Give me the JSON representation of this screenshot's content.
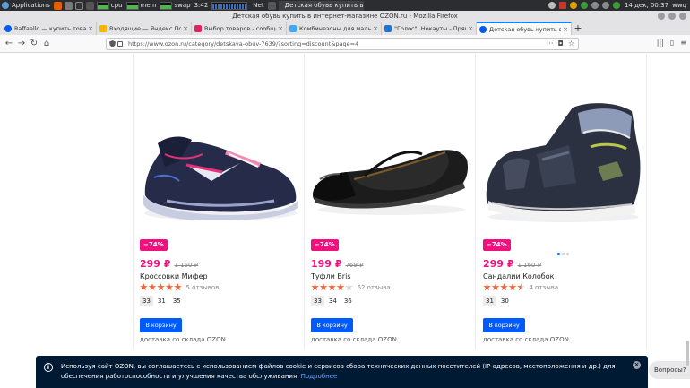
{
  "os_panel": {
    "apps_label": "Applications",
    "cpu_label": "cpu",
    "mem_label": "mem",
    "swap_label": "swap",
    "time_left": "3:42",
    "net_label": "Net",
    "active_task": "Детская обувь купить в ин...",
    "clock": "14 дек, 00:37",
    "user": "wwq"
  },
  "browser": {
    "window_title": "Детская обувь купить в интернет-магазине OZON.ru - Mozilla Firefox",
    "tabs": [
      {
        "label": "Raffaello — купить товары",
        "color": "#005bff"
      },
      {
        "label": "Входящие — Яндекс.Почта",
        "color": "#f7b500"
      },
      {
        "label": "Выбор товаров - сообщество",
        "color": "#e0245e"
      },
      {
        "label": "Комбинезоны для мальчиков",
        "color": "#3fa9f5"
      },
      {
        "label": "\"Голос\". Нокауты - Прямой",
        "color": "#1e74d0"
      },
      {
        "label": "Детская обувь купить в интернет",
        "color": "#005bff"
      }
    ],
    "new_tab": "+",
    "url": "https://www.ozon.ru/category/detskaya-obuv-7639/?sorting=discount&page=4"
  },
  "products": [
    {
      "discount": "−74%",
      "price": "299 ₽",
      "old_price": "1 150 ₽",
      "title": "Кроссовки Мифер",
      "rating": 5,
      "reviews": "5 отзывов",
      "sizes": [
        "33",
        "31",
        "35"
      ],
      "selected_size": 0,
      "cart_label": "В корзину",
      "delivery": "доставка со склада OZON"
    },
    {
      "discount": "−74%",
      "price": "199 ₽",
      "old_price": "769 ₽",
      "title": "Туфли Bris",
      "rating": 4,
      "reviews": "62 отзыва",
      "sizes": [
        "33",
        "34",
        "36"
      ],
      "selected_size": 0,
      "cart_label": "В корзину",
      "delivery": "доставка со склада OZON"
    },
    {
      "discount": "−74%",
      "price": "299 ₽",
      "old_price": "1 160 ₽",
      "title": "Сандалии Колобок",
      "rating": 4.5,
      "reviews": "4 отзыва",
      "sizes": [
        "31",
        "30"
      ],
      "selected_size": 0,
      "cart_label": "В корзину",
      "delivery": "доставка со склада OZON"
    }
  ],
  "cookie_banner": {
    "text": "Используя сайт OZON, вы соглашаетесь с использованием файлов cookie и сервисов сбора технических данных посетителей (IP-адресов, местоположения и др.) для обеспечения работоспособности и улучшения качества обслуживания.",
    "more_link": "Подробнее",
    "close_label": "×"
  },
  "chat_widget": {
    "label": "Вопросы?"
  },
  "colors": {
    "ozon_blue": "#005bff",
    "discount_pink": "#f1117e",
    "star_orange": "#f1653b",
    "banner_bg": "#001a34"
  }
}
